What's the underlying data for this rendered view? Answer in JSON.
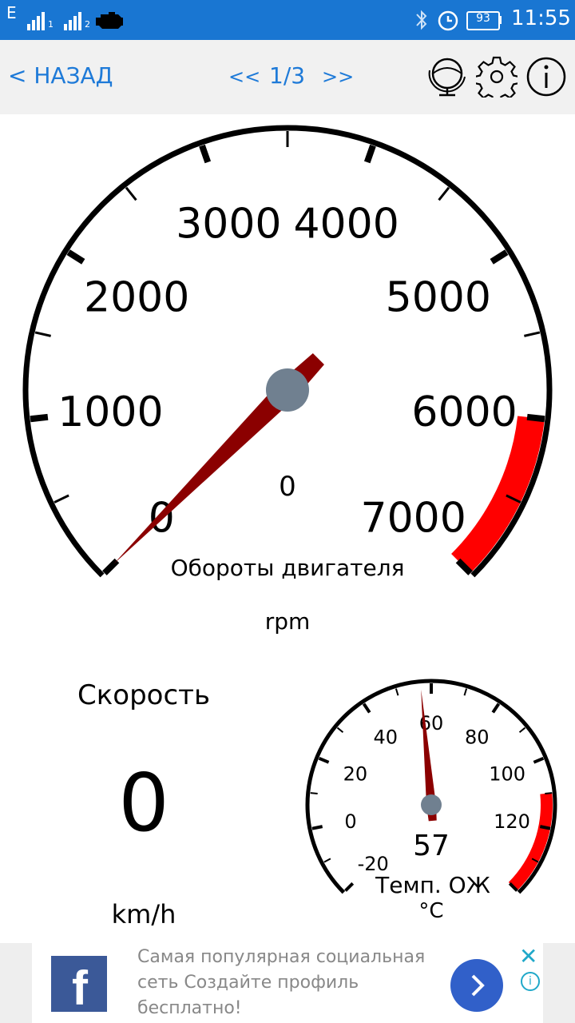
{
  "status_bar": {
    "network": "E",
    "sim1": "1",
    "sim2": "2",
    "battery": "93",
    "time": "11:55",
    "icons": [
      "signal-icon",
      "engine-icon",
      "bluetooth-icon",
      "alarm-icon",
      "battery-icon"
    ]
  },
  "nav": {
    "back_label": "< НАЗАД",
    "prev_label": "<<",
    "page": "1/3",
    "next_label": ">>",
    "icons": [
      "globe-icon",
      "gear-icon",
      "info-icon"
    ]
  },
  "rpm_gauge": {
    "ticks": [
      "0",
      "1000",
      "2000",
      "3000",
      "4000",
      "5000",
      "6000",
      "7000"
    ],
    "value_text": "0",
    "title": "Обороты двигателя",
    "unit": "rpm",
    "value": 0,
    "redline_from": 6000,
    "max": 7000,
    "needle_color": "#8b0000",
    "redline_color": "#ff0000",
    "hub_color": "#708090"
  },
  "speed": {
    "label": "Скорость",
    "value": "0",
    "unit": "km/h"
  },
  "temp_gauge": {
    "ticks": [
      "-20",
      "0",
      "20",
      "40",
      "60",
      "80",
      "100",
      "120"
    ],
    "value": 57,
    "value_text": "57",
    "title": "Темп. ОЖ",
    "unit": "°C",
    "min": -20,
    "max": 140,
    "redline_from": 110
  },
  "ad": {
    "text": "Самая популярная социальная сеть Создайте профиль бесплатно!",
    "logo_letter": "f",
    "close": "✕",
    "info": "i",
    "brand_color": "#3b5998"
  }
}
